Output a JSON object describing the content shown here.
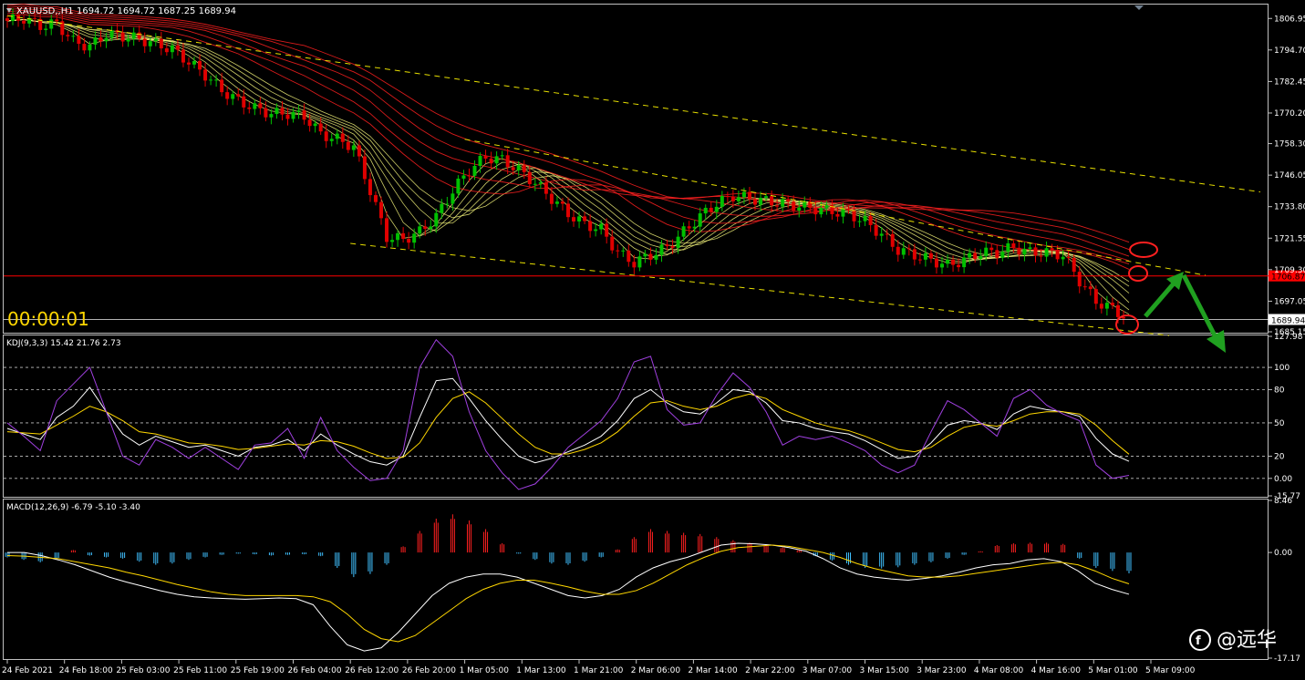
{
  "window": {
    "symbol_label": "XAUUSD,,H1",
    "ohlc": "1694.72 1694.72 1687.25 1689.94",
    "timer": "00:00:01"
  },
  "watermark": "@远华",
  "colors": {
    "background": "#000000",
    "grid": "#c0c0c0",
    "bull_candle": "#00c000",
    "bear_candle": "#e00000",
    "channel": "#e8e000",
    "ma_yellow": "#ffff80",
    "ma_red": "#ff2020",
    "hline_red": "#ff0000",
    "kdj_k": "#ffffff",
    "kdj_d": "#ffd700",
    "kdj_j": "#a040e0",
    "macd_pos": "#ff2020",
    "macd_neg": "#40c0ff",
    "arrow": "#20a020",
    "annotation_circle": "#ff2020"
  },
  "icons": [
    "dropdown-triangle-icon",
    "scroll-marker-icon"
  ],
  "chart_data": [
    {
      "panel": "price",
      "type": "candlestick",
      "title": "XAUUSD,,H1",
      "ylim": [
        1685.15,
        1812.0
      ],
      "y_ticks": [
        "1806.95",
        "1794.70",
        "1782.45",
        "1770.20",
        "1758.30",
        "1746.05",
        "1733.80",
        "1721.55",
        "1709.30",
        "1697.05",
        "1685.15"
      ],
      "price_markers": [
        {
          "label": "1706.87",
          "value": 1706.87,
          "color": "#ff0000"
        },
        {
          "label": "1689.94",
          "value": 1689.94,
          "color": "#ffffff"
        }
      ],
      "x_labels": [
        "24 Feb 2021",
        "24 Feb 18:00",
        "25 Feb 03:00",
        "25 Feb 11:00",
        "25 Feb 19:00",
        "26 Feb 04:00",
        "26 Feb 12:00",
        "26 Feb 20:00",
        "1 Mar 05:00",
        "1 Mar 13:00",
        "1 Mar 21:00",
        "2 Mar 06:00",
        "2 Mar 14:00",
        "2 Mar 22:00",
        "3 Mar 07:00",
        "3 Mar 15:00",
        "3 Mar 23:00",
        "4 Mar 08:00",
        "4 Mar 16:00",
        "5 Mar 01:00",
        "5 Mar 09:00"
      ],
      "close_path": [
        1806,
        1807,
        1804,
        1805,
        1798,
        1796,
        1801,
        1800,
        1799,
        1797,
        1795,
        1790,
        1785,
        1779,
        1775,
        1772,
        1770,
        1770,
        1769,
        1762,
        1760,
        1757,
        1740,
        1722,
        1721,
        1724,
        1730,
        1740,
        1748,
        1753,
        1752,
        1748,
        1743,
        1737,
        1731,
        1727,
        1725,
        1716,
        1712,
        1715,
        1718,
        1724,
        1730,
        1735,
        1738,
        1737,
        1736,
        1735,
        1734,
        1733,
        1732,
        1731,
        1728,
        1723,
        1717,
        1715,
        1713,
        1711,
        1713,
        1716,
        1716,
        1718,
        1716,
        1716,
        1715,
        1705,
        1697,
        1694,
        1690
      ],
      "channel_lines": [
        {
          "from": {
            "x": "24 Feb 2021",
            "y": 1808.0
          },
          "to": {
            "x": "5 Mar 09:00",
            "y": 1745.5
          }
        },
        {
          "from": {
            "x": "1 Mar 05:00",
            "y": 1760.0
          },
          "to": {
            "x": "5 Mar 09:00",
            "y": 1711.0
          }
        },
        {
          "from": {
            "x": "26 Feb 12:00",
            "y": 1719.5
          },
          "to": {
            "x": "5 Mar 09:00",
            "y": 1684.5
          }
        }
      ]
    },
    {
      "panel": "kdj",
      "type": "line",
      "title": "KDJ(9,3,3) 15.42 21.76 2.73",
      "ylim": [
        -15.77,
        127.98
      ],
      "y_ticks": [
        "127.98",
        "100",
        "80",
        "50",
        "20",
        "0.00",
        "-15.77"
      ],
      "levels": [
        100,
        80,
        50,
        20,
        0
      ],
      "series": [
        {
          "name": "K",
          "values": [
            45,
            40,
            35,
            55,
            65,
            82,
            60,
            40,
            30,
            38,
            33,
            28,
            30,
            25,
            20,
            28,
            30,
            35,
            25,
            40,
            30,
            22,
            15,
            12,
            20,
            55,
            88,
            90,
            72,
            52,
            35,
            20,
            14,
            18,
            24,
            30,
            38,
            52,
            72,
            80,
            68,
            60,
            58,
            68,
            80,
            78,
            68,
            52,
            50,
            45,
            42,
            40,
            34,
            26,
            18,
            20,
            32,
            48,
            52,
            50,
            44,
            58,
            65,
            62,
            60,
            56,
            36,
            22,
            15.42
          ]
        },
        {
          "name": "D",
          "values": [
            42,
            41,
            40,
            48,
            56,
            65,
            60,
            52,
            42,
            40,
            36,
            32,
            31,
            29,
            26,
            27,
            29,
            31,
            30,
            34,
            33,
            29,
            23,
            18,
            19,
            32,
            55,
            72,
            78,
            68,
            54,
            40,
            28,
            22,
            22,
            26,
            32,
            42,
            56,
            68,
            70,
            65,
            62,
            65,
            72,
            76,
            72,
            62,
            56,
            50,
            46,
            43,
            38,
            32,
            26,
            24,
            28,
            38,
            46,
            49,
            47,
            52,
            58,
            60,
            60,
            58,
            48,
            34,
            21.76
          ]
        },
        {
          "name": "J",
          "values": [
            50,
            38,
            25,
            70,
            85,
            100,
            60,
            20,
            12,
            35,
            28,
            18,
            28,
            18,
            8,
            30,
            32,
            45,
            18,
            55,
            25,
            10,
            -2,
            0,
            25,
            100,
            125,
            110,
            60,
            25,
            5,
            -10,
            -5,
            10,
            28,
            40,
            52,
            72,
            105,
            110,
            62,
            48,
            50,
            75,
            95,
            82,
            60,
            30,
            38,
            35,
            38,
            32,
            25,
            12,
            5,
            12,
            42,
            70,
            62,
            50,
            38,
            72,
            80,
            66,
            58,
            52,
            12,
            0,
            2.73
          ]
        }
      ]
    },
    {
      "panel": "macd",
      "type": "bar",
      "title": "MACD(12,26,9) -6.79 -5.10 -3.40",
      "ylim": [
        -17.17,
        8.46
      ],
      "y_ticks": [
        "8.46",
        "0.00",
        "-17.17"
      ],
      "series": [
        {
          "name": "histogram",
          "values": [
            -0.8,
            -1.2,
            -1.6,
            -1.0,
            0.4,
            -0.5,
            -0.8,
            -1.0,
            -1.5,
            -2.0,
            -1.8,
            -1.2,
            -0.8,
            -0.4,
            -0.2,
            -0.3,
            -0.5,
            -0.4,
            -0.3,
            -0.6,
            -2.5,
            -4.0,
            -3.5,
            -2.0,
            1.0,
            3.5,
            5.5,
            6.2,
            5.2,
            3.8,
            1.5,
            -0.2,
            -1.2,
            -1.8,
            -2.0,
            -1.5,
            -0.8,
            0.5,
            2.5,
            3.8,
            3.5,
            3.2,
            3.0,
            2.5,
            2.0,
            1.6,
            1.2,
            0.8,
            0.4,
            -0.6,
            -1.3,
            -2.0,
            -2.5,
            -2.6,
            -2.4,
            -2.0,
            -1.6,
            -1.0,
            -0.4,
            0.2,
            1.2,
            1.5,
            1.6,
            1.6,
            1.4,
            -1.0,
            -2.5,
            -3.0,
            -3.4
          ]
        },
        {
          "name": "MACD",
          "values": [
            0,
            0,
            -0.5,
            -1.2,
            -2.0,
            -3.0,
            -4.0,
            -4.8,
            -5.5,
            -6.2,
            -6.8,
            -7.2,
            -7.4,
            -7.5,
            -7.6,
            -7.5,
            -7.4,
            -7.5,
            -8.5,
            -12.0,
            -15.0,
            -16.0,
            -15.5,
            -13.0,
            -10.0,
            -7.0,
            -5.0,
            -4.0,
            -3.5,
            -3.5,
            -4.0,
            -5.0,
            -6.0,
            -7.0,
            -7.4,
            -7.0,
            -6.0,
            -4.0,
            -2.5,
            -1.5,
            -0.8,
            0.2,
            1.2,
            1.5,
            1.4,
            1.2,
            0.8,
            0.2,
            -1.0,
            -2.5,
            -3.5,
            -4.0,
            -4.3,
            -4.5,
            -4.2,
            -3.8,
            -3.2,
            -2.5,
            -2.0,
            -1.8,
            -1.2,
            -1.0,
            -1.5,
            -3.0,
            -5.0,
            -6.0,
            -6.79
          ]
        },
        {
          "name": "Signal",
          "values": [
            -0.5,
            -0.6,
            -0.8,
            -1.0,
            -1.5,
            -2.0,
            -2.5,
            -3.2,
            -3.8,
            -4.5,
            -5.2,
            -5.8,
            -6.4,
            -6.8,
            -7.0,
            -7.0,
            -7.0,
            -7.0,
            -7.2,
            -8.0,
            -10.0,
            -12.5,
            -14.0,
            -14.5,
            -13.5,
            -11.5,
            -9.5,
            -7.5,
            -6.0,
            -5.0,
            -4.5,
            -4.5,
            -5.0,
            -5.6,
            -6.3,
            -6.8,
            -6.8,
            -6.2,
            -5.0,
            -3.5,
            -2.0,
            -0.8,
            0.2,
            0.8,
            1.0,
            1.2,
            1.0,
            0.5,
            0.0,
            -0.8,
            -1.8,
            -2.6,
            -3.2,
            -3.8,
            -4.0,
            -4.0,
            -3.8,
            -3.4,
            -3.0,
            -2.6,
            -2.2,
            -1.8,
            -1.6,
            -2.0,
            -3.0,
            -4.2,
            -5.1
          ]
        }
      ]
    }
  ]
}
